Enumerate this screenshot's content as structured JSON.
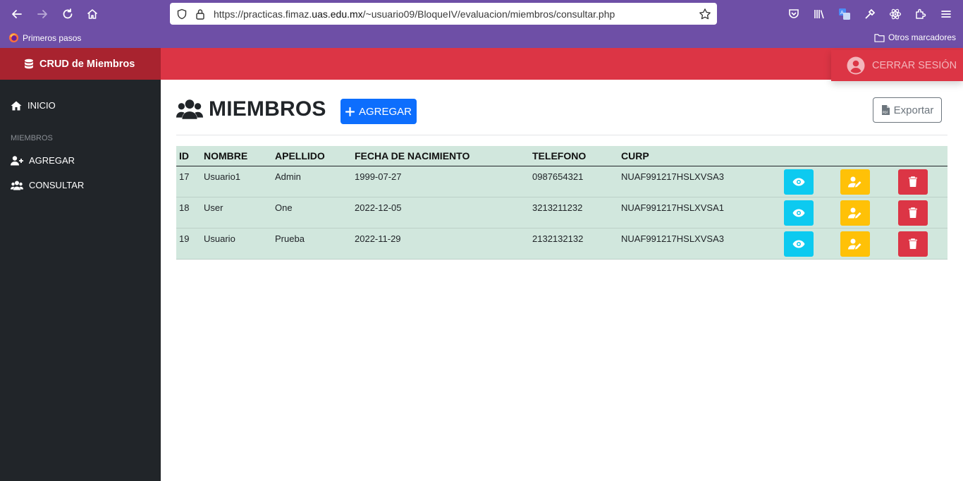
{
  "browser": {
    "url_prefix": "https://practicas.fimaz.",
    "url_domain": "uas.edu.mx",
    "url_suffix": "/~usuario09/BloqueIV/evaluacion/miembros/consultar.php",
    "bookmark_primeros": "Primeros pasos",
    "bookmark_otros": "Otros marcadores"
  },
  "sidebar": {
    "brand": "CRUD de Miembros",
    "inicio": "INICIO",
    "section_heading": "MIEMBROS",
    "agregar": "AGREGAR",
    "consultar": "CONSULTAR"
  },
  "topbar": {
    "logout_label": "CERRAR SESIÓN"
  },
  "main": {
    "title": "MIEMBROS",
    "add_label": "AGREGAR",
    "export_label": "Exportar"
  },
  "table": {
    "headers": [
      "ID",
      "NOMBRE",
      "APELLIDO",
      "FECHA DE NACIMIENTO",
      "TELEFONO",
      "CURP"
    ],
    "rows": [
      {
        "id": "17",
        "nombre": "Usuario1",
        "apellido": "Admin",
        "fecha": "1999-07-27",
        "telefono": "0987654321",
        "curp": "NUAF991217HSLXVSA3"
      },
      {
        "id": "18",
        "nombre": "User",
        "apellido": "One",
        "fecha": "2022-12-05",
        "telefono": "3213211232",
        "curp": "NUAF991217HSLXVSA1"
      },
      {
        "id": "19",
        "nombre": "Usuario",
        "apellido": "Prueba",
        "fecha": "2022-11-29",
        "telefono": "2132132132",
        "curp": "NUAF991217HSLXVSA3"
      }
    ]
  },
  "colors": {
    "browser": "#6e4fa6",
    "brand": "#a8232f",
    "topbar": "#dc3545",
    "sidebar": "#212529",
    "primary": "#0d6efd",
    "info": "#0dcaf0",
    "warning": "#ffc107",
    "danger": "#dc3545",
    "table_bg": "#d1e7dd"
  },
  "icons": {
    "view": "eye-icon",
    "edit": "user-edit-icon",
    "delete": "trash-icon"
  }
}
